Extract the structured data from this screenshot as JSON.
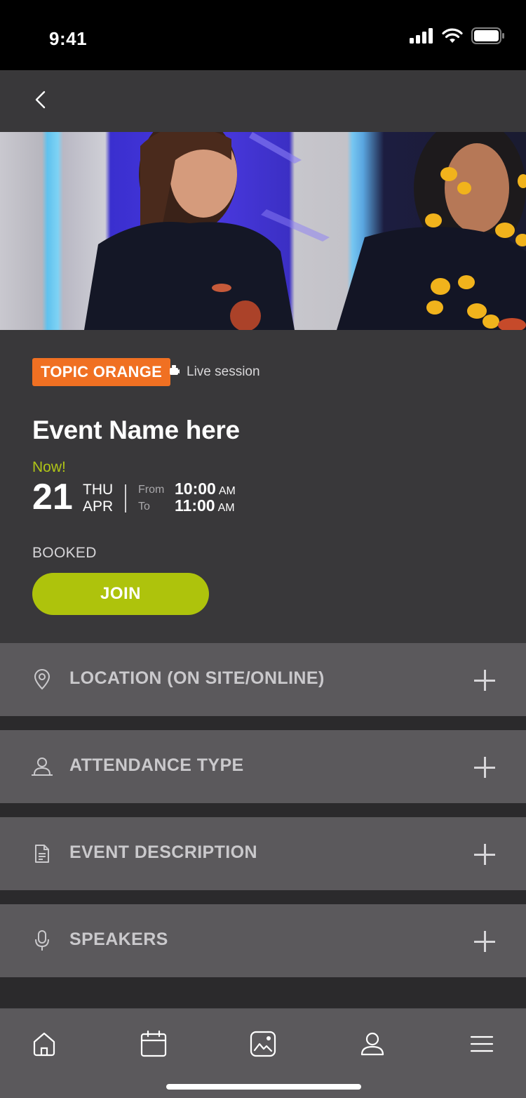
{
  "status_bar": {
    "time": "9:41",
    "icons": [
      "signal-icon",
      "wifi-icon",
      "battery-icon"
    ]
  },
  "nav": {
    "back_icon": "chevron-left-icon"
  },
  "hero": {
    "icon": "photo"
  },
  "event": {
    "topic_badge": "TOPIC ORANGE",
    "topic_color": "#f07022",
    "session_icon": "video-camera-icon",
    "session_type": "Live session",
    "title": "Event Name here",
    "now_label": "Now!",
    "now_color": "#b0c517",
    "date_day": "21",
    "date_weekday": "THU",
    "date_month": "APR",
    "from_label": "From",
    "to_label": "To",
    "from_time": "10:00",
    "from_ampm": "AM",
    "to_time": "11:00",
    "to_ampm": "AM",
    "booked_label": "BOOKED",
    "join_label": "JOIN",
    "join_color": "#aec30c"
  },
  "accordions": [
    {
      "icon": "location-pin-icon",
      "label": "LOCATION (ON SITE/ONLINE)"
    },
    {
      "icon": "person-icon",
      "label": "ATTENDANCE TYPE"
    },
    {
      "icon": "document-icon",
      "label": "EVENT DESCRIPTION"
    },
    {
      "icon": "microphone-icon",
      "label": "SPEAKERS"
    }
  ],
  "tab_bar": {
    "tabs": [
      {
        "icon": "home-icon"
      },
      {
        "icon": "calendar-icon"
      },
      {
        "icon": "gallery-icon"
      },
      {
        "icon": "profile-icon"
      },
      {
        "icon": "menu-icon"
      }
    ]
  }
}
